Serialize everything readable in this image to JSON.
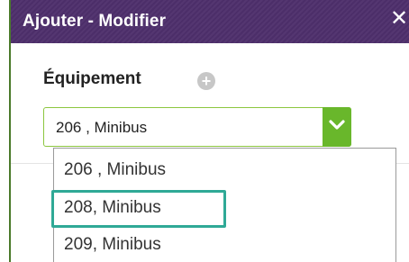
{
  "dialog": {
    "title": "Ajouter - Modifier",
    "close_label": "✕"
  },
  "field": {
    "label": "Équipement",
    "add_icon": "plus-circle-icon"
  },
  "select": {
    "value": "206 , Minibus",
    "toggle_icon": "chevron-down-icon"
  },
  "dropdown": {
    "options": [
      {
        "label": "206 , Minibus"
      },
      {
        "label": "208, Minibus"
      },
      {
        "label": "209, Minibus"
      }
    ],
    "highlighted_index": 1
  },
  "colors": {
    "titlebar": "#4e2f6c",
    "accent_green": "#69b72b",
    "highlight": "#2fa996"
  }
}
